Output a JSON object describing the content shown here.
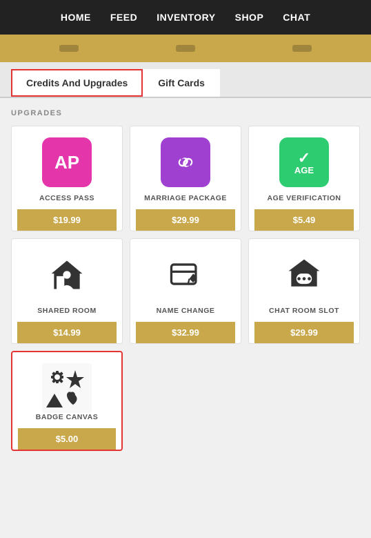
{
  "nav": {
    "items": [
      {
        "label": "HOME",
        "href": "#"
      },
      {
        "label": "FEED",
        "href": "#"
      },
      {
        "label": "INVENTORY",
        "href": "#"
      },
      {
        "label": "SHOP",
        "href": "#"
      },
      {
        "label": "CHAT",
        "href": "#"
      }
    ]
  },
  "tabs": {
    "items": [
      {
        "label": "Credits And Upgrades",
        "active": true
      },
      {
        "label": "Gift Cards",
        "active": false
      }
    ]
  },
  "section": {
    "label": "UPGRADES"
  },
  "upgrades": [
    {
      "id": "access-pass",
      "name": "ACCESS PASS",
      "price": "$19.99",
      "icon_type": "ap",
      "highlighted": false
    },
    {
      "id": "marriage-package",
      "name": "MARRIAGE PACKAGE",
      "price": "$29.99",
      "icon_type": "marriage",
      "highlighted": false
    },
    {
      "id": "age-verification",
      "name": "AGE VERIFICATION",
      "price": "$5.49",
      "icon_type": "age",
      "highlighted": false
    },
    {
      "id": "shared-room",
      "name": "SHARED ROOM",
      "price": "$14.99",
      "icon_type": "shared-room",
      "highlighted": false
    },
    {
      "id": "name-change",
      "name": "NAME CHANGE",
      "price": "$32.99",
      "icon_type": "name-change",
      "highlighted": false
    },
    {
      "id": "chat-room-slot",
      "name": "CHAT ROOM SLOT",
      "price": "$29.99",
      "icon_type": "chat-room",
      "highlighted": false
    },
    {
      "id": "badge-canvas",
      "name": "BADGE CANVAS",
      "price": "$5.00",
      "icon_type": "badge-canvas",
      "highlighted": true
    }
  ]
}
